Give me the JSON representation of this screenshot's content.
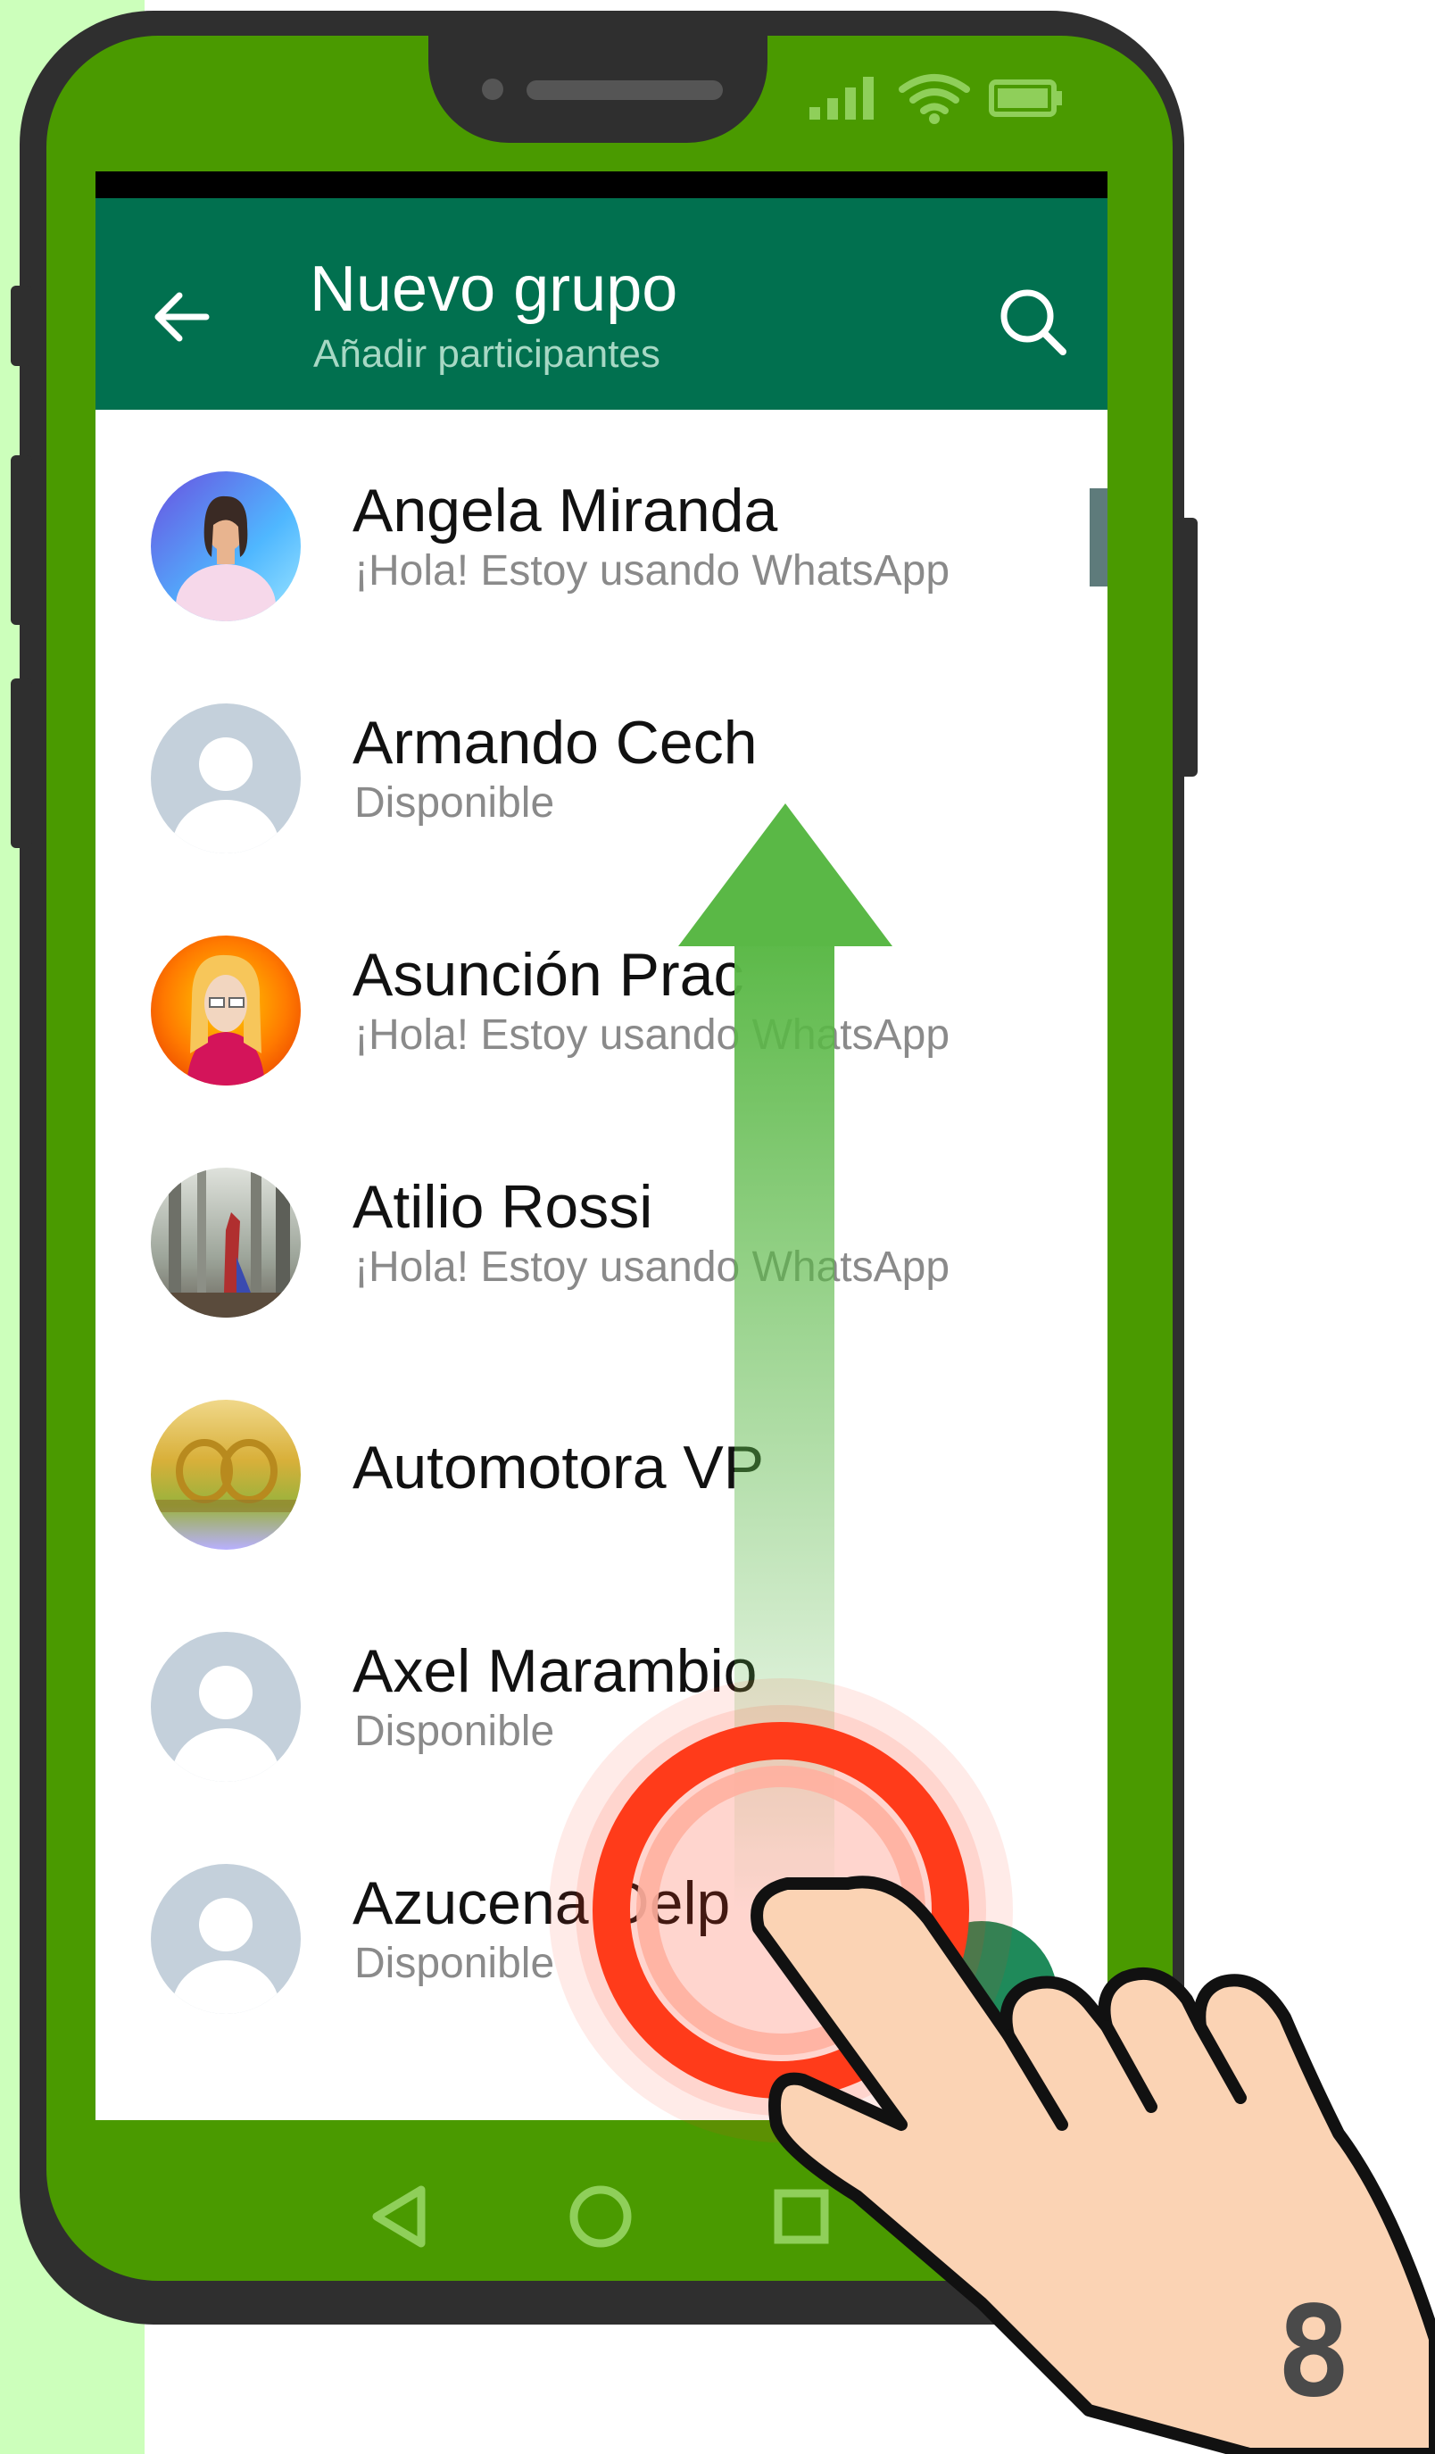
{
  "header": {
    "title": "Nuevo grupo",
    "subtitle": "Añadir participantes"
  },
  "contacts": [
    {
      "name": "Angela Miranda",
      "status": "¡Hola! Estoy usando WhatsApp",
      "avatar": "photo-woman-icon"
    },
    {
      "name": "Armando Cech",
      "status": "Disponible",
      "avatar": "default-user-icon"
    },
    {
      "name": "Asunción Prac",
      "status": "¡Hola! Estoy usando WhatsApp",
      "avatar": "cartoon-woman-icon"
    },
    {
      "name": "Atilio Rossi",
      "status": "¡Hola! Estoy usando WhatsApp",
      "avatar": "forest-photo-icon"
    },
    {
      "name": "Automotora VP",
      "status": "",
      "avatar": "gold-logo-icon"
    },
    {
      "name": "Axel Marambio",
      "status": "Disponible",
      "avatar": "default-user-icon"
    },
    {
      "name": "Azucena Delp",
      "status": "Disponible",
      "avatar": "default-user-icon"
    }
  ],
  "step": "8",
  "colors": {
    "appbar": "#01704f",
    "phone_frame": "#4a9a00",
    "arrow": "#5ab846",
    "tap_ring": "#ff3b1a",
    "side_strip": "#ccffbb"
  },
  "icons": {
    "back": "arrow-left-icon",
    "search": "search-icon",
    "nav": [
      "triangle-back-icon",
      "circle-home-icon",
      "square-recents-icon"
    ],
    "gesture": "swipe-up-arrow-icon"
  }
}
